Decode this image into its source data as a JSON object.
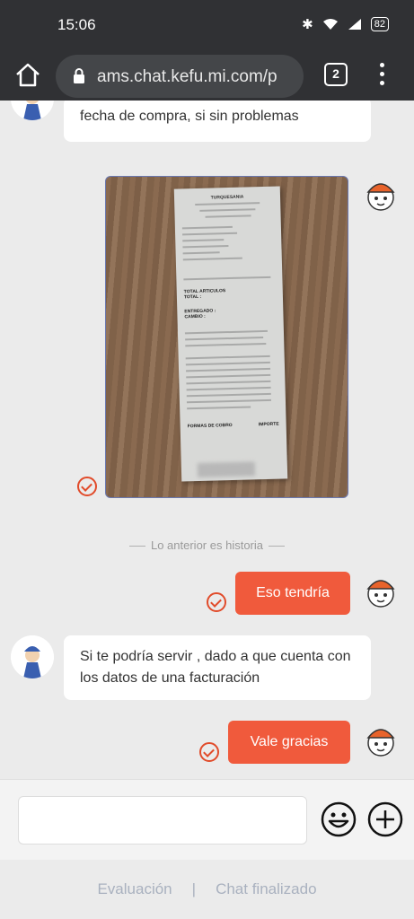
{
  "status_bar": {
    "time": "15:06",
    "battery": "82"
  },
  "browser": {
    "url": "ams.chat.kefu.mi.com/p",
    "tab_count": "2"
  },
  "chat": {
    "messages": [
      {
        "from": "agent",
        "text": "fecha de compra, si sin problemas"
      },
      {
        "from": "user",
        "type": "image",
        "description": "receipt-photo"
      },
      {
        "from": "user",
        "text": "Eso tendría"
      },
      {
        "from": "agent",
        "text": "Si te podría servir , dado a que cuenta con los datos de una facturación"
      },
      {
        "from": "user",
        "text": "Vale gracias"
      }
    ],
    "history_divider": "Lo anterior es historia"
  },
  "receipt": {
    "store": "TURQUESANIA",
    "total_articulos": "TOTAL ARTICULOS",
    "total": "TOTAL :",
    "entregado": "ENTREGADO :",
    "cambio": "CAMBIO :",
    "forma_cobro": "FORMAS DE COBRO",
    "importe": "IMPORTE"
  },
  "input": {
    "placeholder": ""
  },
  "footer": {
    "evaluacion": "Evaluación",
    "separator": "|",
    "chat_finalizado": "Chat finalizado"
  },
  "colors": {
    "accent": "#f05a3c",
    "toolbar": "#303134",
    "background": "#ebebeb"
  }
}
